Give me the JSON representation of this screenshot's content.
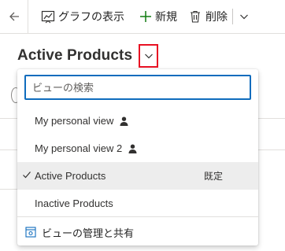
{
  "toolbar": {
    "show_chart_label": "グラフの表示",
    "new_label": "新規",
    "delete_label": "削除"
  },
  "view_selector": {
    "title": "Active Products"
  },
  "dropdown": {
    "search_placeholder": "ビューの検索",
    "items": [
      {
        "label": "My personal view",
        "personal": true
      },
      {
        "label": "My personal view 2",
        "personal": true
      },
      {
        "label": "Active Products",
        "selected": true,
        "badge": "既定"
      },
      {
        "label": "Inactive Products"
      }
    ],
    "manage_label": "ビューの管理と共有"
  },
  "colors": {
    "accent_blue": "#0f6cbd",
    "new_plus_green": "#107c10",
    "highlight_red": "#e81123",
    "selected_row_bg": "#ededed"
  }
}
